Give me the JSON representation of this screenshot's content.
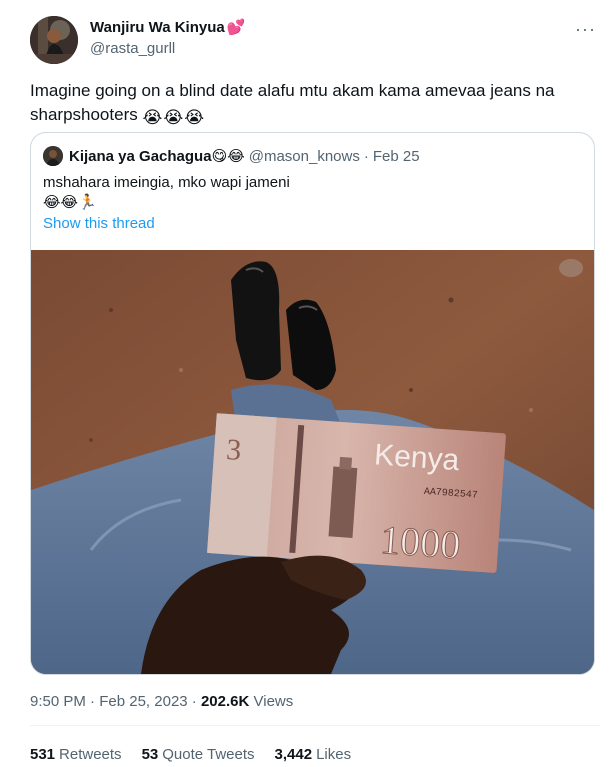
{
  "author": {
    "display_name": "Wanjiru Wa Kinyua",
    "name_emoji": "💕",
    "handle": "@rasta_gurll"
  },
  "menu": {
    "more_label": "···"
  },
  "tweet": {
    "text": "Imagine going on a blind date alafu mtu akam kama amevaa jeans na sharpshooters",
    "emojis": [
      "😭",
      "😭",
      "😭"
    ]
  },
  "quote": {
    "display_name": "Kijana ya Gachagua",
    "name_emojis": "😋😂",
    "handle": "@mason_knows",
    "separator": "·",
    "date": "Feb 25",
    "text": "mshahara imeingia, mko wapi jameni",
    "emoji_line": "😂😂🏃",
    "show_thread": "Show this thread",
    "media": {
      "banknote_country": "Kenya",
      "banknote_value": "1000",
      "banknote_serial": "AA7982547"
    }
  },
  "meta": {
    "time": "9:50 PM",
    "separator": "·",
    "date": "Feb 25, 2023",
    "views_count": "202.6K",
    "views_label": "Views"
  },
  "stats": {
    "retweets_count": "531",
    "retweets_label": "Retweets",
    "quotes_count": "53",
    "quotes_label": "Quote Tweets",
    "likes_count": "3,442",
    "likes_label": "Likes"
  },
  "colors": {
    "link": "#1d9bf0",
    "secondary_text": "#536471",
    "border": "#cfd9de"
  }
}
